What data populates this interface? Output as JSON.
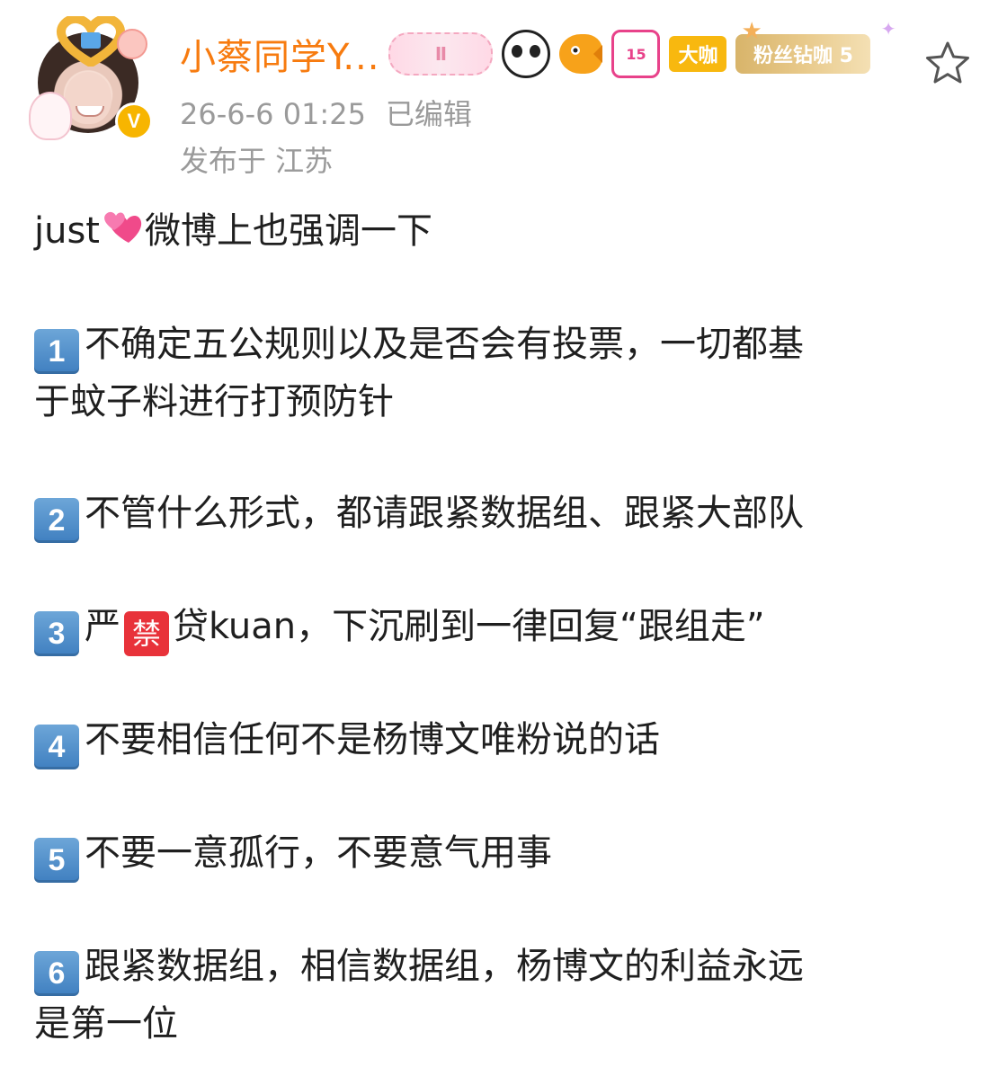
{
  "header": {
    "username": "小蔡同学Y...",
    "badges": {
      "rank_icon": "rank-ii-icon",
      "rank_text": "Ⅱ",
      "panda_icon": "panda-icon",
      "fish_icon": "fish-icon",
      "gem_text": "15",
      "daka_text": "大咖",
      "fans_text": "粉丝钻咖 5"
    },
    "verified_mark": "V",
    "timestamp": "26-6-6 01:25",
    "edited_label": "已编辑",
    "location": "发布于 江苏",
    "colors": {
      "username": "#f77b0f",
      "meta": "#9a9a9a"
    }
  },
  "post": {
    "intro_prefix": "just",
    "intro_suffix": "微博上也强调一下",
    "items": [
      {
        "num": "1",
        "lines": [
          "不确定五公规则以及是否会有投票，一切都基",
          "于蚊子料进行打预防针"
        ]
      },
      {
        "num": "2",
        "lines": [
          "不管什么形式，都请跟紧数据组、跟紧大部队"
        ]
      },
      {
        "num": "3",
        "prefix": "严",
        "ban_char": "禁",
        "suffix": "贷kuan，下沉刷到一律回复“跟组走”"
      },
      {
        "num": "4",
        "lines": [
          "不要相信任何不是杨博文唯粉说的话"
        ]
      },
      {
        "num": "5",
        "lines": [
          "不要一意孤行，不要意气用事"
        ]
      },
      {
        "num": "6",
        "lines": [
          "跟紧数据组，相信数据组，杨博文的利益永远",
          "是第一位"
        ]
      }
    ]
  }
}
